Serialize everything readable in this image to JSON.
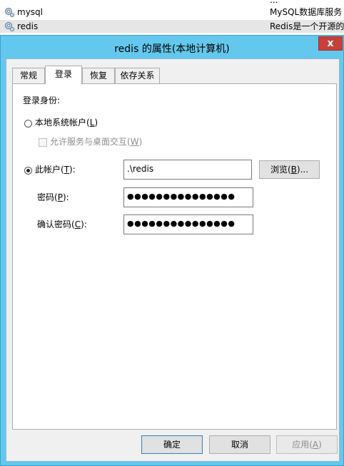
{
  "services": [
    {
      "name": "",
      "desc": "..."
    },
    {
      "name": "mysql",
      "desc": "MySQL数据库服务"
    },
    {
      "name": "redis",
      "desc": "Redis是一个开源的"
    }
  ],
  "dialog": {
    "title": "redis 的属性(本地计算机)",
    "close_label": "x",
    "tabs": [
      {
        "label": "常规"
      },
      {
        "label": "登录"
      },
      {
        "label": "恢复"
      },
      {
        "label": "依存关系"
      }
    ],
    "logon": {
      "section_label": "登录身份:",
      "local_system": {
        "text": "本地系统帐户(",
        "key": "L",
        "end": ")"
      },
      "allow_desktop": {
        "text": "允许服务与桌面交互(",
        "key": "W",
        "end": ")"
      },
      "this_account": {
        "text": "此帐户(",
        "key": "T",
        "end": "):"
      },
      "account_value": ".\\redis",
      "browse": {
        "text": "浏览(",
        "key": "B",
        "end": ")..."
      },
      "password": {
        "text": "密码(",
        "key": "P",
        "end": "):"
      },
      "password_value": "●●●●●●●●●●●●●●●",
      "confirm": {
        "text": "确认密码(",
        "key": "C",
        "end": "):"
      },
      "confirm_value": "●●●●●●●●●●●●●●●"
    },
    "buttons": {
      "ok": "确定",
      "cancel": "取消",
      "apply": {
        "text": "应用(",
        "key": "A",
        "end": ")"
      }
    }
  }
}
